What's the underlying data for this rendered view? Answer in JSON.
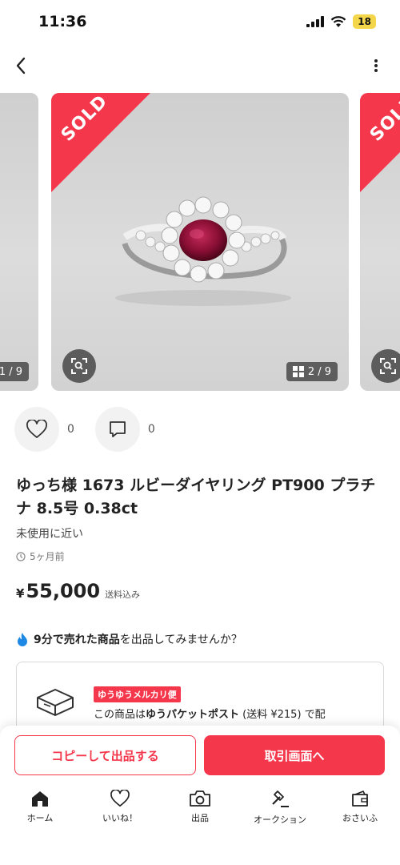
{
  "status": {
    "time": "11:36",
    "battery": "18"
  },
  "gallery": {
    "prev_counter": "1 / 9",
    "main_counter": "2 / 9",
    "sold_label": "SOLD"
  },
  "social": {
    "likes": "0",
    "comments": "0"
  },
  "item": {
    "title": "ゆっち様 1673 ルビーダイヤリング PT900 プラチナ 8.5号 0.38ct",
    "condition": "未使用に近い",
    "posted": "5ヶ月前",
    "currency": "¥",
    "price": "55,000",
    "shipping_included": "送料込み"
  },
  "promo": {
    "bold_text": "9分で売れた商品",
    "rest_text": "を出品してみませんか？"
  },
  "shipping": {
    "badge": "ゆうゆうメルカリ便",
    "line_prefix": "この商品は",
    "method": "ゆうパケットポスト",
    "line_suffix": " (送料 ¥215) で配"
  },
  "buttons": {
    "copy": "コピーして出品する",
    "trade": "取引画面へ"
  },
  "tabs": [
    {
      "label": "ホーム",
      "icon": "home-icon"
    },
    {
      "label": "いいね！",
      "icon": "heart-icon"
    },
    {
      "label": "出品",
      "icon": "camera-icon"
    },
    {
      "label": "オークション",
      "icon": "gavel-icon"
    },
    {
      "label": "おさいふ",
      "icon": "wallet-icon"
    }
  ],
  "colors": {
    "accent": "#f5374c",
    "battery": "#f3d64a"
  }
}
